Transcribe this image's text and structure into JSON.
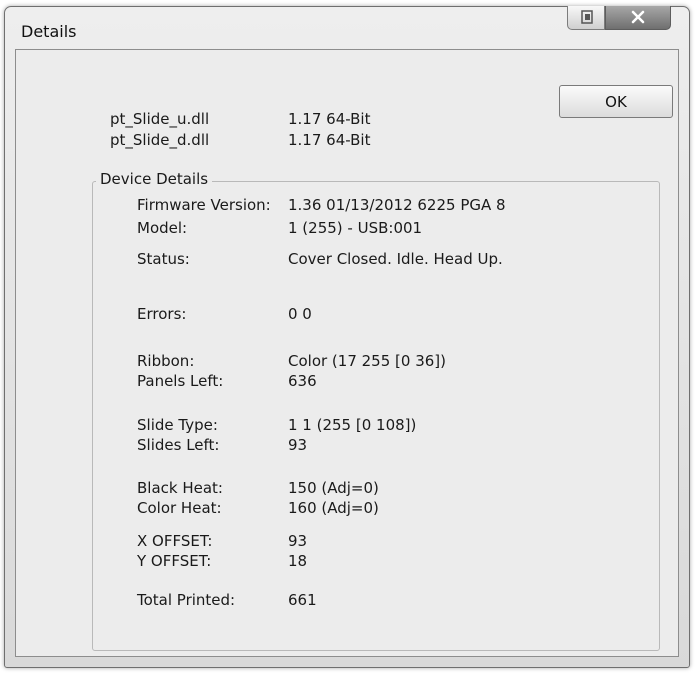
{
  "window": {
    "title": "Details",
    "restore_icon": "restore-icon",
    "close_icon": "close-icon"
  },
  "ok_label": "OK",
  "dlls": [
    {
      "name": "pt_Slide_u.dll",
      "version": "1.17  64-Bit"
    },
    {
      "name": "pt_Slide_d.dll",
      "version": "1.17  64-Bit"
    }
  ],
  "device_details": {
    "legend": "Device Details",
    "rows": [
      {
        "label": "Firmware Version:",
        "value": "1.36 01/13/2012  6225  PGA 8"
      },
      {
        "label": "Model:",
        "value": "1 (255) - USB:001"
      },
      {
        "label": "Status:",
        "value": "Cover Closed. Idle. Head Up."
      },
      {
        "label": "Errors:",
        "value": "0 0"
      },
      {
        "label": "Ribbon:",
        "value": "Color (17 255 [0 36])"
      },
      {
        "label": "Panels Left:",
        "value": "636"
      },
      {
        "label": "Slide Type:",
        "value": "1 1 (255 [0 108])"
      },
      {
        "label": "Slides Left:",
        "value": "93"
      },
      {
        "label": "Black Heat:",
        "value": "150  (Adj=0)"
      },
      {
        "label": "Color Heat:",
        "value": "160  (Adj=0)"
      },
      {
        "label": "X OFFSET:",
        "value": "93"
      },
      {
        "label": "Y OFFSET:",
        "value": "18"
      },
      {
        "label": "Total  Printed:",
        "value": "661"
      }
    ]
  }
}
